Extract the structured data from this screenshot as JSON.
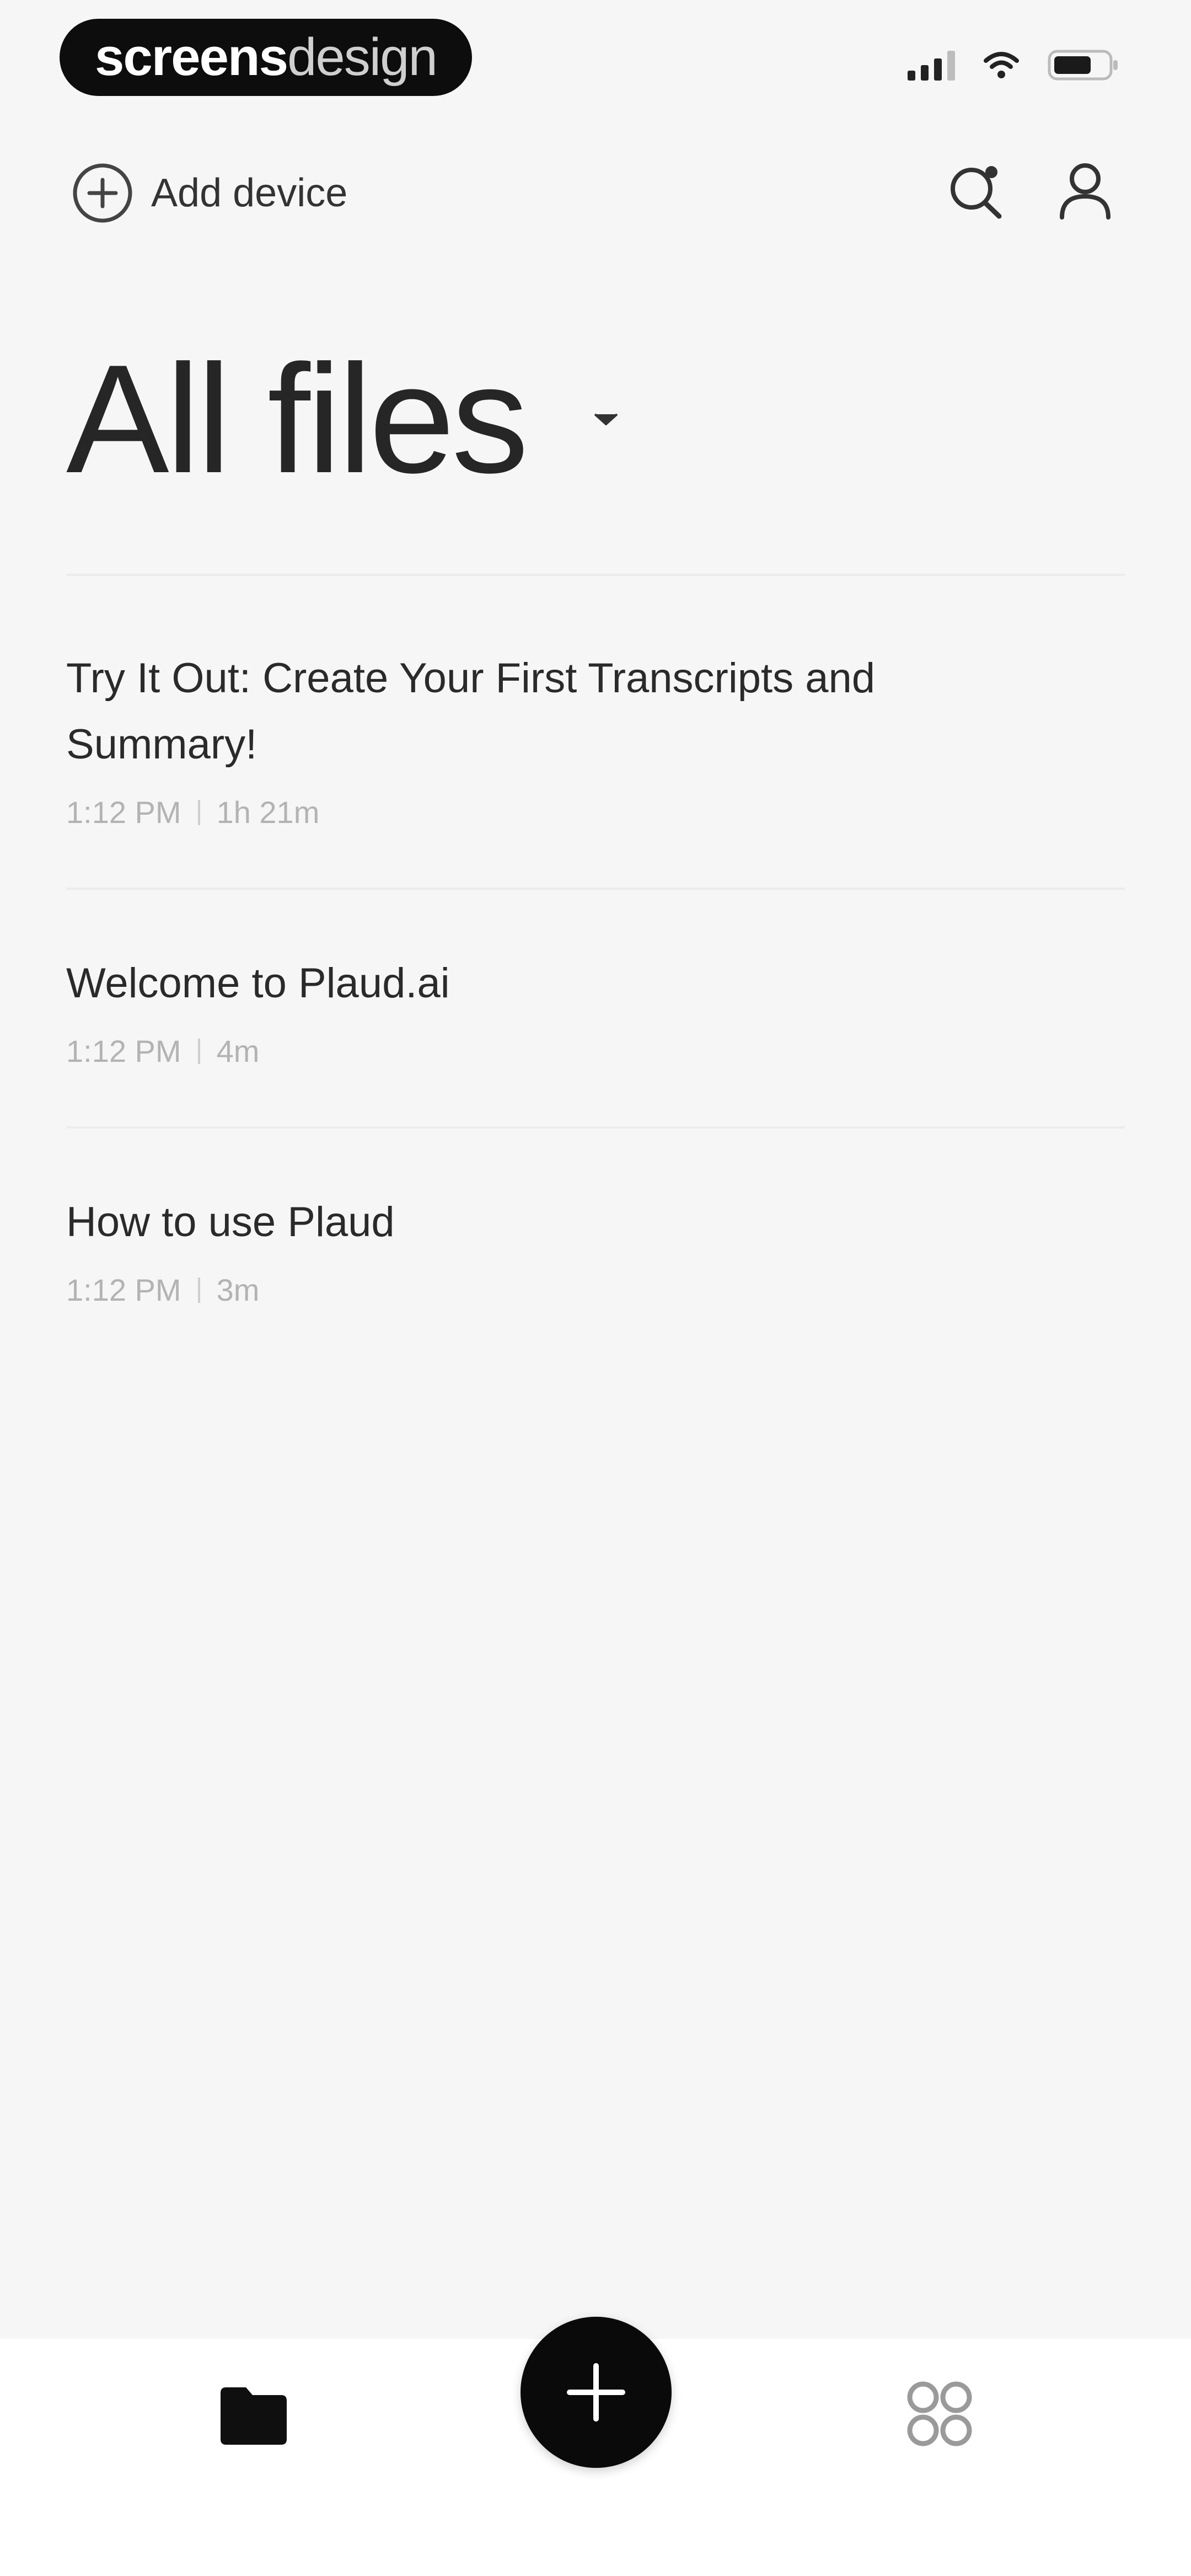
{
  "status_bar": {
    "brand_part1": "screens",
    "brand_part2": "design",
    "icons": [
      "signal-icon",
      "wifi-icon",
      "battery-icon"
    ]
  },
  "top_bar": {
    "add_device_label": "Add device",
    "icons": [
      "plus-circle-icon",
      "search-icon",
      "profile-icon"
    ]
  },
  "header": {
    "title": "All files"
  },
  "files": [
    {
      "title": "Try It Out: Create Your First Transcripts and Summary!",
      "time": "1:12 PM",
      "duration": "1h 21m"
    },
    {
      "title": "Welcome to Plaud.ai",
      "time": "1:12 PM",
      "duration": "4m"
    },
    {
      "title": "How to use Plaud",
      "time": "1:12 PM",
      "duration": "3m"
    }
  ],
  "bottom_nav": {
    "icons": [
      "folder-icon",
      "plus-icon",
      "apps-grid-icon"
    ]
  },
  "colors": {
    "background": "#f6f6f6",
    "accent": "#0a0a0a",
    "meta_text": "#b3b3b3"
  }
}
